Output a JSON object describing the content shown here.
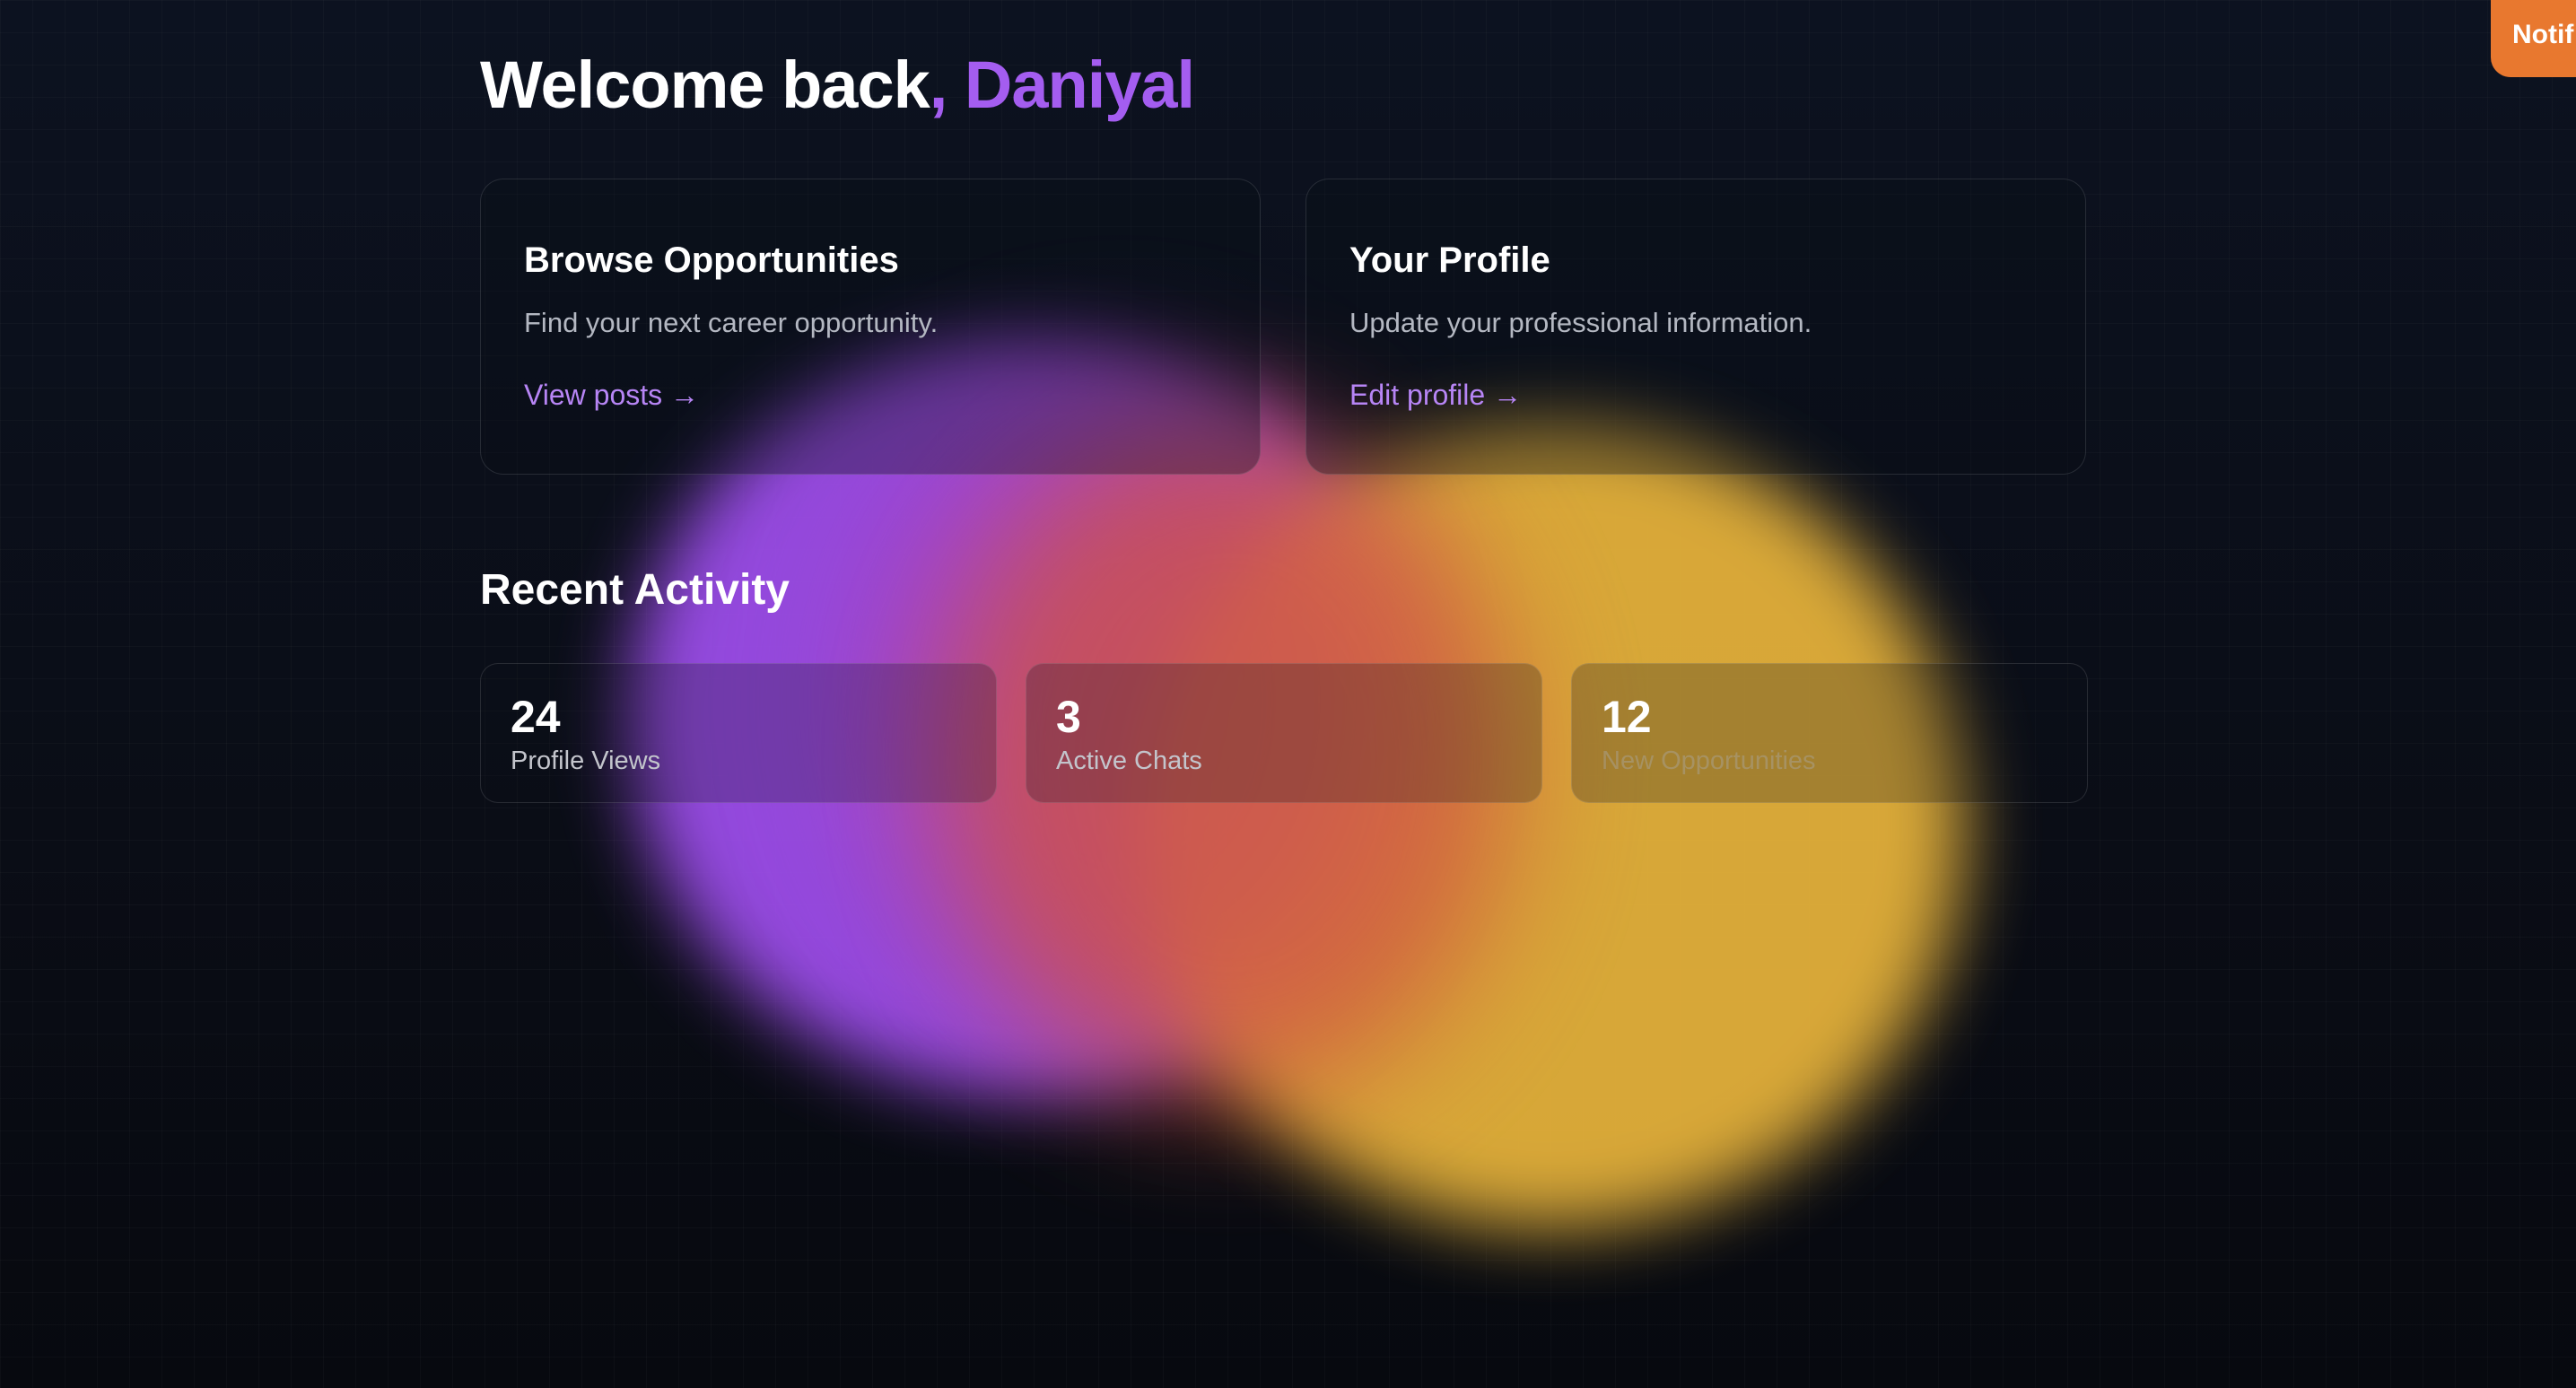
{
  "header": {
    "greeting": "Welcome back",
    "separator": ", ",
    "user_name": "Daniyal"
  },
  "cards": [
    {
      "title": "Browse Opportunities",
      "description": "Find your next career opportunity.",
      "link_label": "View posts →"
    },
    {
      "title": "Your Profile",
      "description": "Update your professional information.",
      "link_label": "Edit profile →"
    }
  ],
  "recent_activity": {
    "title": "Recent Activity",
    "stats": [
      {
        "value": "24",
        "label": "Profile Views"
      },
      {
        "value": "3",
        "label": "Active Chats"
      },
      {
        "value": "12",
        "label": "New Opportunities"
      }
    ]
  },
  "notifications": {
    "tab_label": "Notif"
  },
  "colors": {
    "accent_purple": "#a45df0",
    "link_purple": "#b785f5",
    "notif_orange": "#e8782f",
    "background": "#0b0e17"
  }
}
